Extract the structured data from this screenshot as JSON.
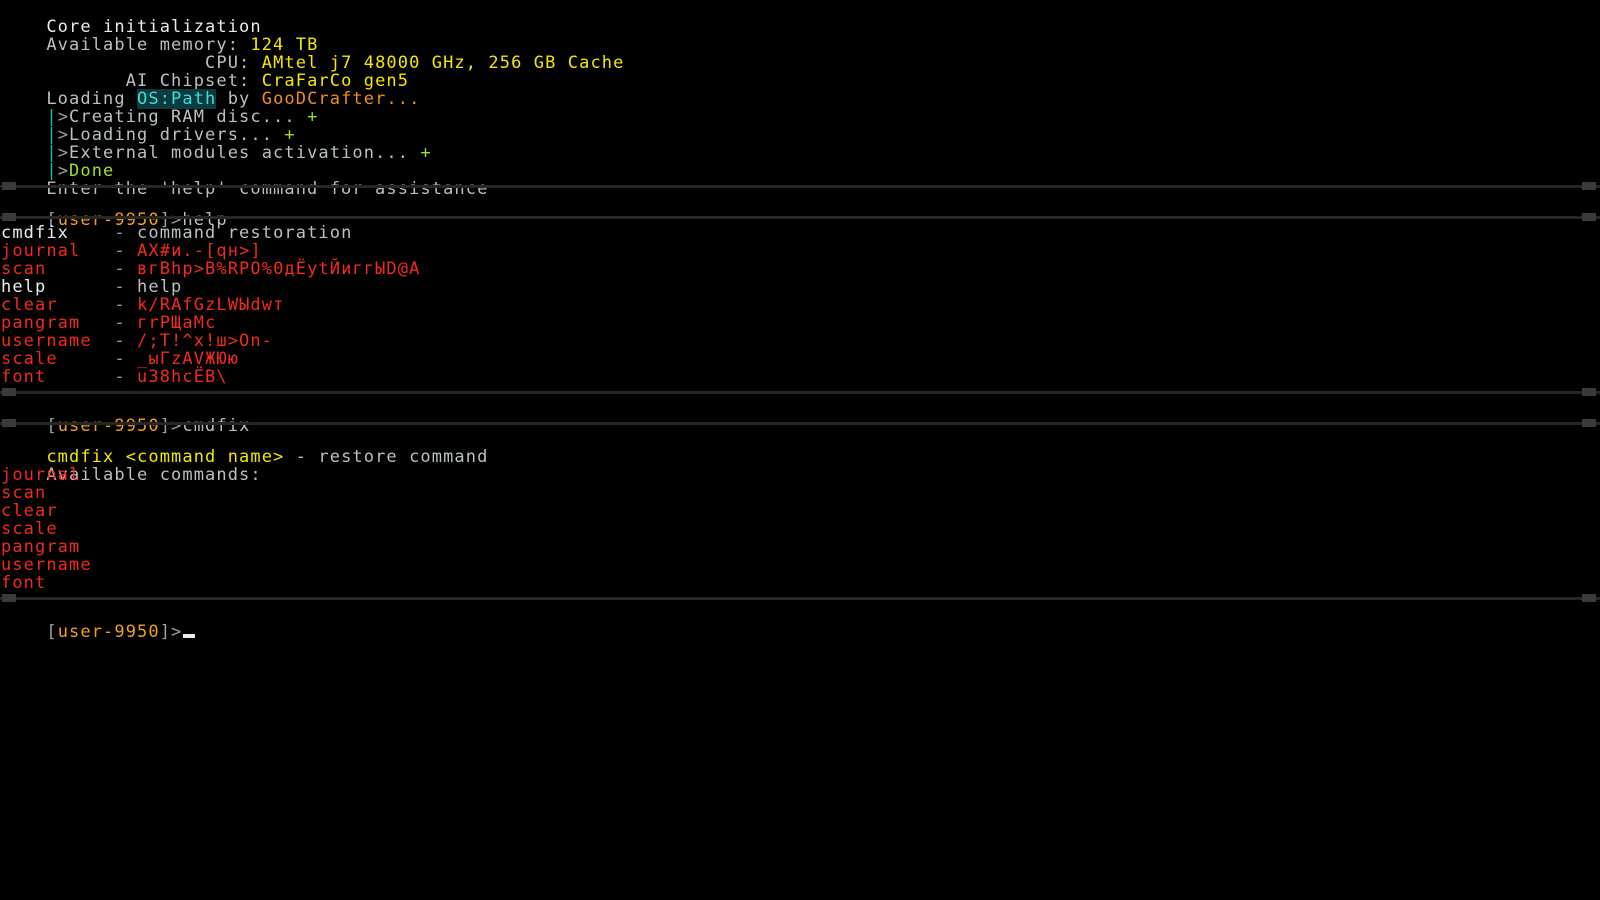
{
  "terminal": {
    "background": "#000000",
    "colors": {
      "label": "#b9c0c0",
      "value": "#f2e800",
      "dim": "#9aa2a2",
      "bright": "#e9eded",
      "teal": "#1fb7b7",
      "green": "#9ee02a",
      "cyan_highlight_fg": "#35e0e0",
      "cyan_highlight_bg": "#0c3a3d",
      "orange": "#f08c1e",
      "user_orange": "#f0a01e",
      "red": "#f02b1e",
      "separator": "#262626"
    }
  },
  "boot": {
    "title": "Core initialization",
    "specs": [
      {
        "label": "Available memory:",
        "value": "124 TB"
      },
      {
        "label": "CPU:",
        "value": "AMtel j7 48000 GHz, 256 GB Cache"
      },
      {
        "label": "AI Chipset:",
        "value": "CraFarCo gen5"
      }
    ],
    "loading_prefix": "Loading ",
    "os_name": "OS:Path",
    "loading_by": " by ",
    "vendor": "GooDCrafter...",
    "steps": [
      {
        "marker": "|",
        "arrow": ">",
        "text": "Creating RAM disc... ",
        "status": "+"
      },
      {
        "marker": "|",
        "arrow": ">",
        "text": "Loading drivers... ",
        "status": "+"
      },
      {
        "marker": "|",
        "arrow": ">",
        "text": "External modules activation... ",
        "status": "+"
      }
    ],
    "done": {
      "marker": "|",
      "arrow": ">",
      "text": "Done"
    },
    "hint": "Enter the 'help' command for assistance"
  },
  "prompts": {
    "bracket_open": "[",
    "user": "user-9950",
    "bracket_close": "]",
    "caret": ">",
    "help_command": "help",
    "cmdfix_command": "cmdfix",
    "empty_command": ""
  },
  "help_output": {
    "dash": "-",
    "rows": [
      {
        "name": "cmdfix",
        "name_state": "ok",
        "desc": "command restoration",
        "desc_state": "ok"
      },
      {
        "name": "journal",
        "name_state": "broken",
        "desc": "AX#и.-[qн>]",
        "desc_state": "broken"
      },
      {
        "name": "scan",
        "name_state": "broken",
        "desc": "вгBhp>B%RPO%0дЁytЙиггЫD@A",
        "desc_state": "broken"
      },
      {
        "name": "help",
        "name_state": "ok",
        "desc": "help",
        "desc_state": "ok"
      },
      {
        "name": "clear",
        "name_state": "broken",
        "desc": "k/RAfGzLWЫdwт",
        "desc_state": "broken"
      },
      {
        "name": "pangram",
        "name_state": "broken",
        "desc": "гrРЩaMc",
        "desc_state": "broken"
      },
      {
        "name": "username",
        "name_state": "broken",
        "desc": "/;T!^x!ш>On-",
        "desc_state": "broken"
      },
      {
        "name": "scale",
        "name_state": "broken",
        "desc": "_ыГzAVЖЮю",
        "desc_state": "broken"
      },
      {
        "name": "font",
        "name_state": "broken",
        "desc": "u38hcЁB\\",
        "desc_state": "broken"
      }
    ]
  },
  "cmdfix_output": {
    "usage_command": "cmdfix <command name>",
    "usage_desc": " - restore command",
    "available_heading": "Available commands:",
    "available": [
      "journal",
      "scan",
      "clear",
      "scale",
      "pangram",
      "username",
      "font"
    ]
  }
}
